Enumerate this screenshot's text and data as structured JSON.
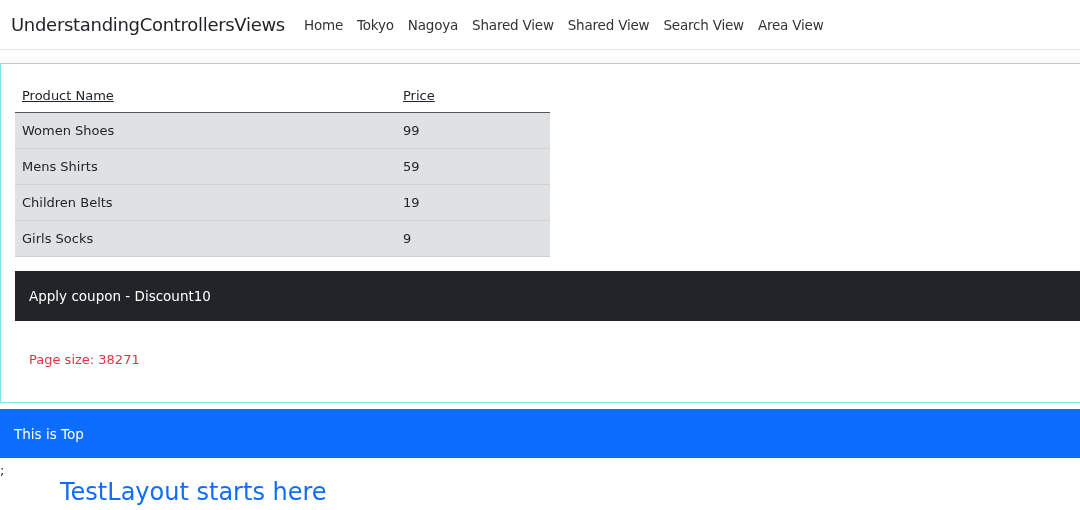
{
  "navbar": {
    "brand": "UnderstandingControllersViews",
    "links": [
      "Home",
      "Tokyo",
      "Nagoya",
      "Shared View",
      "Shared View",
      "Search View",
      "Area View"
    ]
  },
  "table": {
    "columns": [
      "Product Name",
      "Price"
    ],
    "rows": [
      {
        "name": "Women Shoes",
        "price": "99"
      },
      {
        "name": "Mens Shirts",
        "price": "59"
      },
      {
        "name": "Children Belts",
        "price": "19"
      },
      {
        "name": "Girls Socks",
        "price": "9"
      }
    ]
  },
  "coupon_bar": "Apply coupon - Discount10",
  "page_size": "Page size: 38271",
  "top_bar": "This is Top",
  "stray_text": ";",
  "heading": "TestLayout starts here"
}
